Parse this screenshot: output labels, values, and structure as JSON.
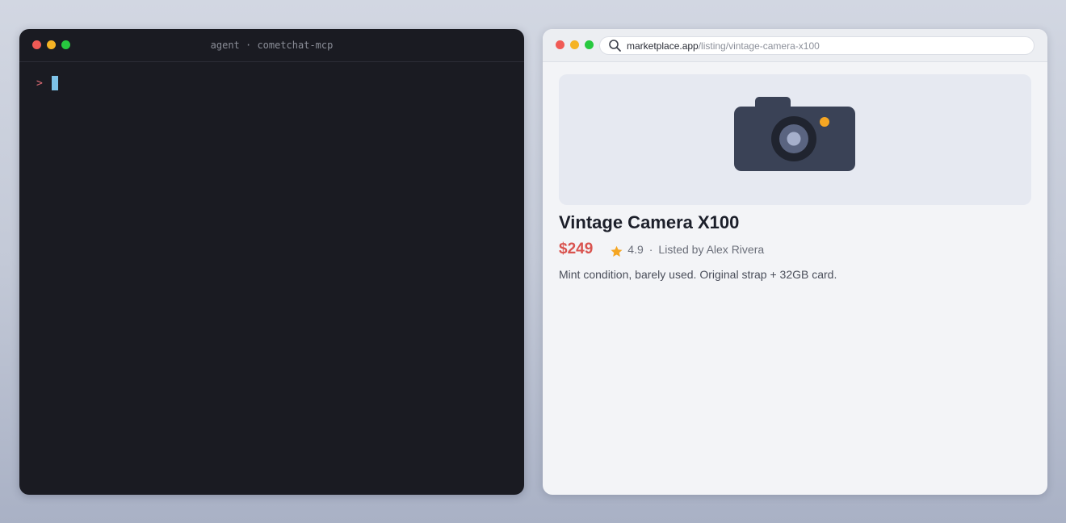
{
  "terminal": {
    "title": "agent · cometchat-mcp",
    "prompt": ">"
  },
  "browser": {
    "url_host": "marketplace.app",
    "url_path": "/listing/vintage-camera-x100"
  },
  "listing": {
    "title": "Vintage Camera X100",
    "price": "$249",
    "rating": "4.9",
    "separator": "·",
    "seller": "Listed by Alex Rivera",
    "description": "Mint condition, barely used. Original strap + 32GB card.",
    "image_icon": "camera-icon"
  },
  "colors": {
    "price": "#d9534f",
    "star": "#f5a623",
    "cursor": "#7ec3e8",
    "prompt": "#e06c75"
  }
}
